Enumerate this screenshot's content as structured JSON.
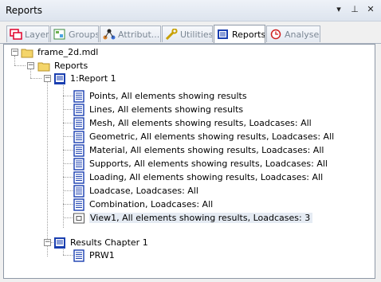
{
  "window": {
    "title": "Reports",
    "pin_glyph": "▾",
    "dock_glyph": "⊥",
    "close_glyph": "✕"
  },
  "tabs": [
    {
      "label": "Layers",
      "icon": "layers-icon"
    },
    {
      "label": "Groups",
      "icon": "groups-icon"
    },
    {
      "label": "Attribut...",
      "icon": "attributes-icon"
    },
    {
      "label": "Utilities",
      "icon": "utilities-icon"
    },
    {
      "label": "Reports",
      "icon": "reports-icon",
      "active": true
    },
    {
      "label": "Analyses",
      "icon": "analyses-icon"
    }
  ],
  "tree": {
    "root": "frame_2d.mdl",
    "reports_folder": "Reports",
    "report": "1:Report 1",
    "items": [
      "Points, All elements showing results",
      "Lines, All elements showing results",
      "Mesh, All elements showing results, Loadcases: All",
      "Geometric, All elements showing results, Loadcases: All",
      "Material, All elements showing results, Loadcases: All",
      "Supports, All elements showing results, Loadcases: All",
      "Loading, All elements showing results, Loadcases: All",
      "Loadcase, Loadcases: All",
      "Combination, Loadcases: All",
      "View1, All elements showing results, Loadcases: 3"
    ],
    "chapter": "Results Chapter 1",
    "chapter_item": "PRW1"
  }
}
